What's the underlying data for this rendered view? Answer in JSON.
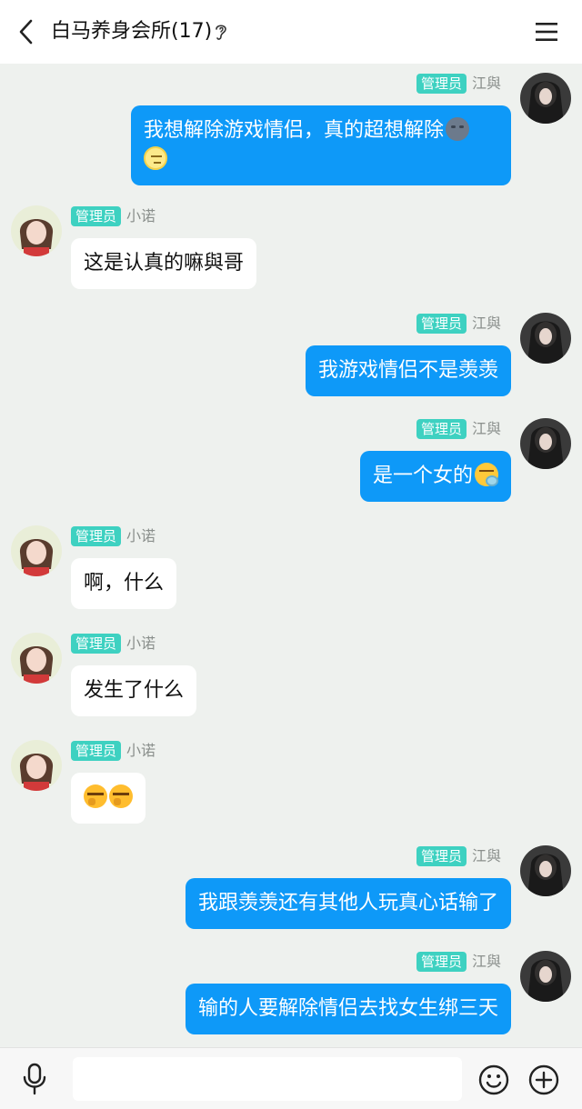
{
  "header": {
    "title": "白马养身会所(17)"
  },
  "input": {
    "placeholder": ""
  },
  "users": {
    "jiangyu": {
      "role": "管理员",
      "name": "江與"
    },
    "xiaonuo": {
      "role": "管理员",
      "name": "小诺"
    }
  },
  "messages": [
    {
      "sender": "江與",
      "side": "right",
      "text": "我想解除游戏情侣，真的超想解除",
      "emoji": [
        "new-moon-face",
        "smirk-face"
      ]
    },
    {
      "sender": "小诺",
      "side": "left",
      "text": "这是认真的嘛與哥"
    },
    {
      "sender": "江與",
      "side": "right",
      "text": "我游戏情侣不是羡羡"
    },
    {
      "sender": "江與",
      "side": "right",
      "text": "是一个女的",
      "emoji": [
        "thinking-face"
      ]
    },
    {
      "sender": "小诺",
      "side": "left",
      "text": "啊，什么"
    },
    {
      "sender": "小诺",
      "side": "left",
      "text": "发生了什么"
    },
    {
      "sender": "小诺",
      "side": "left",
      "text": "",
      "emoji": [
        "crying-face",
        "crying-face"
      ]
    },
    {
      "sender": "江與",
      "side": "right",
      "text": "我跟羡羡还有其他人玩真心话输了"
    },
    {
      "sender": "江與",
      "side": "right",
      "text": "输的人要解除情侣去找女生绑三天"
    }
  ]
}
